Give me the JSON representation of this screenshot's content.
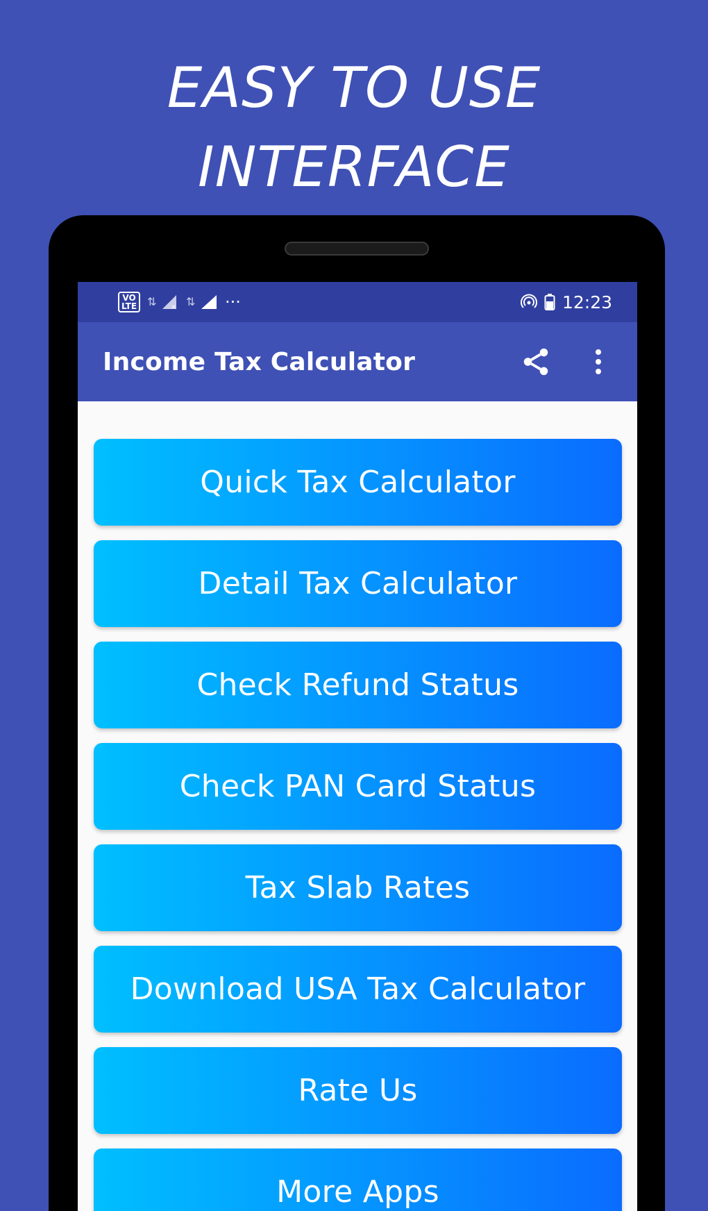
{
  "promo": {
    "headline_line1": "EASY TO USE",
    "headline_line2": "INTERFACE"
  },
  "statusbar": {
    "volte_top": "VO",
    "volte_bottom": "LTE",
    "more": "···",
    "time": "12:23"
  },
  "appbar": {
    "title": "Income Tax Calculator",
    "icons": [
      "share-icon",
      "more-vert-icon"
    ]
  },
  "menu": {
    "items": [
      {
        "label": "Quick Tax Calculator"
      },
      {
        "label": "Detail Tax Calculator"
      },
      {
        "label": "Check Refund Status"
      },
      {
        "label": "Check PAN Card Status"
      },
      {
        "label": "Tax Slab Rates"
      },
      {
        "label": "Download USA Tax Calculator"
      },
      {
        "label": "Rate Us"
      },
      {
        "label": "More Apps"
      }
    ]
  },
  "colors": {
    "background": "#3f51b5",
    "statusbar": "#303f9f",
    "appbar": "#3f51b5",
    "button_gradient_start": "#00bfff",
    "button_gradient_end": "#0a6cff"
  }
}
